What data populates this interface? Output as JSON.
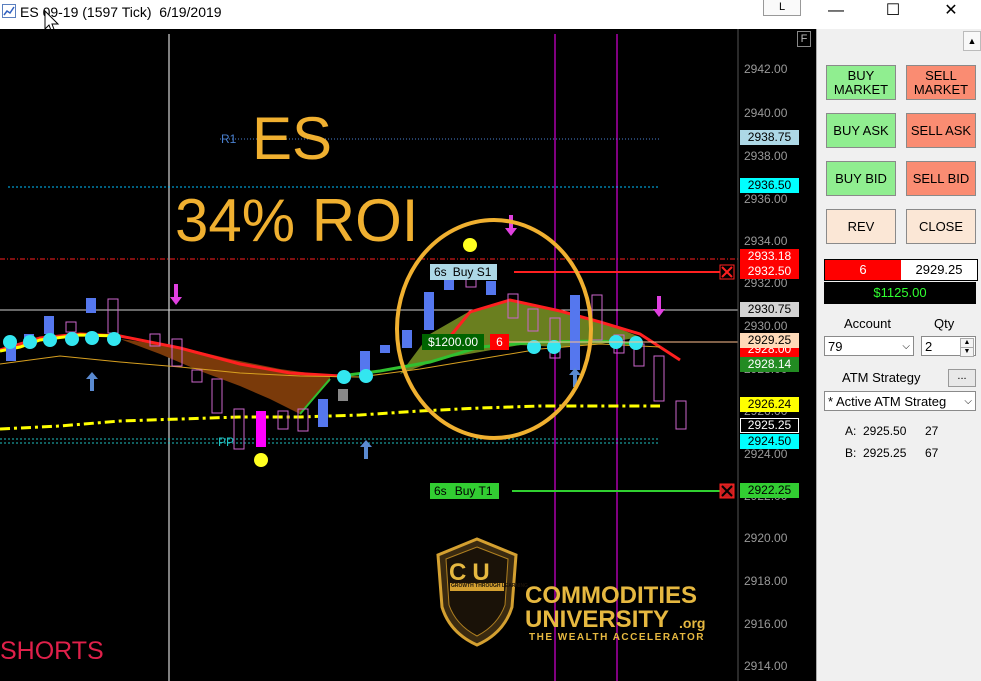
{
  "window": {
    "title": "ES 09-19 (1597 Tick)  6/19/2019",
    "l_button": "L",
    "minimize": "—",
    "maximize": "☐",
    "close": "✕"
  },
  "chart": {
    "f_label": "F",
    "price_ticks": [
      "2942.00",
      "2940.00",
      "2938.00",
      "2936.00",
      "2934.00",
      "2932.00",
      "2930.00",
      "2928.00",
      "2926.00",
      "2924.00",
      "2922.00",
      "2920.00",
      "2918.00",
      "2916.00",
      "2914.00"
    ],
    "price_tags": [
      {
        "value": "2938.75",
        "color": "#add8e6"
      },
      {
        "value": "2936.50",
        "color": "#00ffff"
      },
      {
        "value": "2933.18",
        "color": "#ff0000"
      },
      {
        "value": "2932.50",
        "color": "#ff0000"
      },
      {
        "value": "2930.75",
        "color": "#d3d3d3"
      },
      {
        "value": "2929.25",
        "color": "#ffdab9"
      },
      {
        "value": "2928.00",
        "color": "#ff0000"
      },
      {
        "value": "2928.14",
        "color": "#228b22"
      },
      {
        "value": "2926.24",
        "color": "#ffff00"
      },
      {
        "value": "2925.25",
        "color": "#000000"
      },
      {
        "value": "2924.50",
        "color": "#00ffff"
      },
      {
        "value": "2922.25",
        "color": "#32cd32"
      }
    ],
    "r1_label": "R1",
    "pp_label": "PP",
    "overlay_symbol": "ES",
    "overlay_roi": "34% ROI",
    "shorts_label": "SHORTS",
    "order_buy_s1": {
      "qty": "6s",
      "label": "Buy S1"
    },
    "order_buy_t1": {
      "qty": "6s",
      "label": "Buy T1"
    },
    "position_pnl": "$1200.00",
    "position_qty": "6",
    "logo_letters": "CU",
    "logo_motto": "GROWTH THROUGH LEARNING",
    "logo_line1": "COMMODITIES",
    "logo_line2": "UNIVERSITY",
    "logo_org": ".org",
    "logo_tagline": "THE WEALTH ACCELERATOR"
  },
  "panel": {
    "buy_market": "BUY MARKET",
    "sell_market": "SELL MARKET",
    "buy_ask": "BUY ASK",
    "sell_ask": "SELL ASK",
    "buy_bid": "BUY BID",
    "sell_bid": "SELL BID",
    "rev": "REV",
    "close": "CLOSE",
    "position_qty": "6",
    "position_price": "2929.25",
    "position_pnl": "$1125.00",
    "account_label": "Account",
    "qty_label": "Qty",
    "account_value": "79",
    "qty_value": "2",
    "atm_label": "ATM Strategy",
    "atm_button": "...",
    "atm_value": "* Active ATM Strateg",
    "quote_a_label": "A:",
    "quote_a_price": "2925.50",
    "quote_a_size": "27",
    "quote_b_label": "B:",
    "quote_b_price": "2925.25",
    "quote_b_size": "67"
  },
  "colors": {
    "buy": "#90ee90",
    "sell": "#fa8c72",
    "neutral": "#fbe7d6",
    "overlay_text": "#f0b030"
  }
}
